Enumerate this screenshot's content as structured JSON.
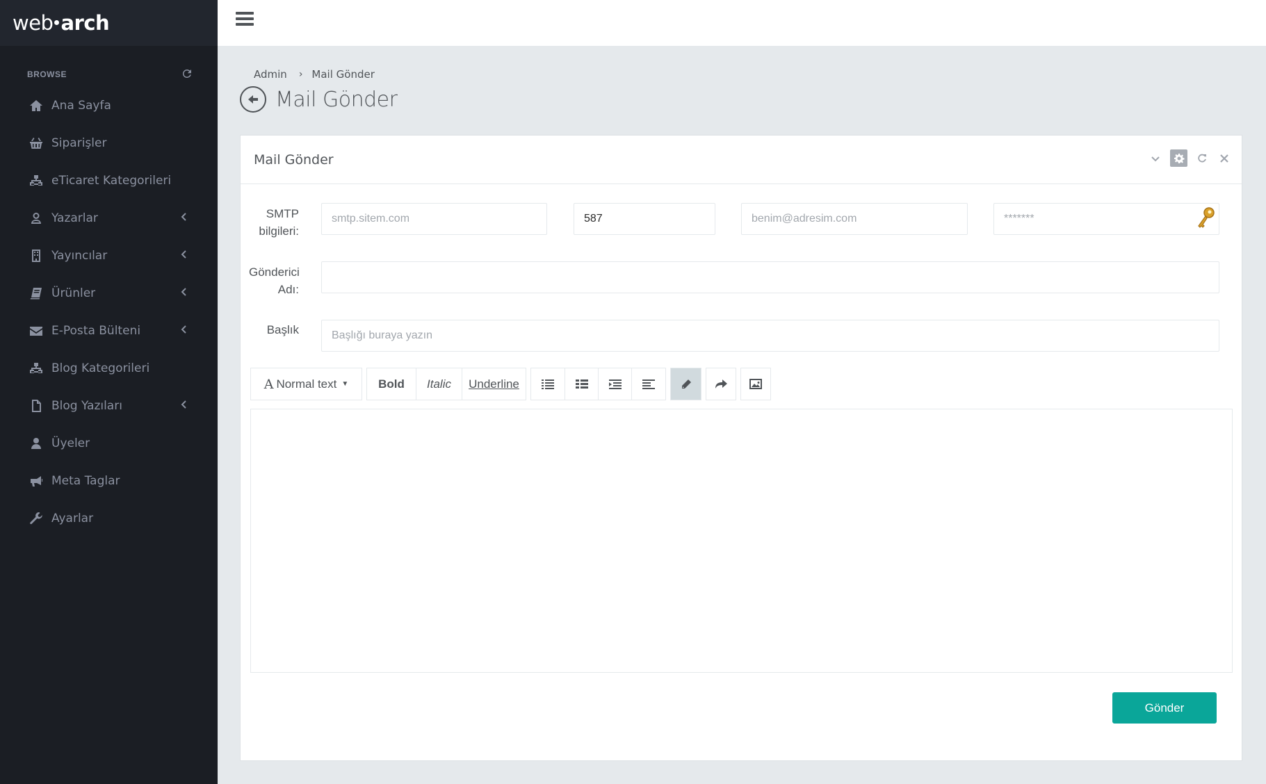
{
  "brand": {
    "logo_left": "web",
    "logo_right": "arch"
  },
  "sidebar": {
    "browse_label": "BROWSE",
    "items": [
      {
        "label": "Ana Sayfa",
        "icon": "home-icon",
        "has_arrow": false
      },
      {
        "label": "Siparişler",
        "icon": "basket-icon",
        "has_arrow": false
      },
      {
        "label": "eTicaret Kategorileri",
        "icon": "sitemap-icon",
        "has_arrow": false
      },
      {
        "label": "Yazarlar",
        "icon": "user-icon",
        "has_arrow": true
      },
      {
        "label": "Yayıncılar",
        "icon": "building-icon",
        "has_arrow": true
      },
      {
        "label": "Ürünler",
        "icon": "book-icon",
        "has_arrow": true
      },
      {
        "label": "E-Posta Bülteni",
        "icon": "envelope-icon",
        "has_arrow": true
      },
      {
        "label": "Blog Kategorileri",
        "icon": "sitemap-icon",
        "has_arrow": false
      },
      {
        "label": "Blog Yazıları",
        "icon": "file-icon",
        "has_arrow": true
      },
      {
        "label": "Üyeler",
        "icon": "user-solid-icon",
        "has_arrow": false
      },
      {
        "label": "Meta Taglar",
        "icon": "bullhorn-icon",
        "has_arrow": false
      },
      {
        "label": "Ayarlar",
        "icon": "wrench-icon",
        "has_arrow": false
      }
    ]
  },
  "breadcrumb": {
    "root": "Admin",
    "current": "Mail Gönder"
  },
  "page_title": "Mail Gönder",
  "panel": {
    "title": "Mail Gönder",
    "smtp_label_1": "SMTP",
    "smtp_label_2": "bilgileri:",
    "smtp_host_placeholder": "smtp.sitem.com",
    "smtp_port_value": "587",
    "smtp_email_placeholder": "benim@adresim.com",
    "smtp_password_placeholder": "*******",
    "sender_label_1": "Gönderici",
    "sender_label_2": "Adı:",
    "sender_value": "",
    "subject_label": "Başlık",
    "subject_placeholder": "Başlığı buraya yazın",
    "toolbar": {
      "font_style": "Normal text",
      "bold": "Bold",
      "italic": "Italic",
      "underline": "Underline"
    },
    "send_button": "Gönder"
  },
  "colors": {
    "sidebar_bg": "#1b1e24",
    "accent": "#0aa699",
    "page_bg": "#e5e9ec"
  }
}
